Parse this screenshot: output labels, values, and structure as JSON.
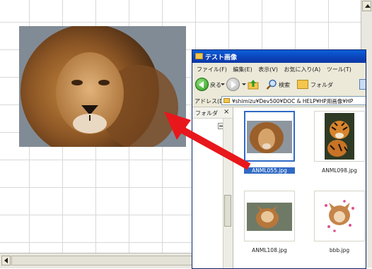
{
  "canvas": {
    "name": "grid-canvas"
  },
  "explorer": {
    "title": "テスト画像",
    "menu": [
      "ファイル(F)",
      "編集(E)",
      "表示(V)",
      "お気に入り(A)",
      "ツール(T)"
    ],
    "toolbar": {
      "back_label": "戻る",
      "search_label": "検索",
      "folders_label": "フォルダ"
    },
    "address": {
      "label": "アドレス(D)",
      "path": "¥shimizu¥Dev500¥DOC & HELP¥HP用画像¥HP"
    },
    "folders_pane": {
      "label": "フォルダ",
      "close": "×"
    },
    "files": [
      {
        "name": "ANML055.jpg",
        "selected": true
      },
      {
        "name": "ANML098.jpg",
        "selected": false
      },
      {
        "name": "ANML108.jpg",
        "selected": false
      },
      {
        "name": "bbb.jpg",
        "selected": false
      }
    ]
  },
  "colors": {
    "arrow": "#e8171c",
    "selection": "#316ac5",
    "titlebar": "#0c3fb3"
  }
}
